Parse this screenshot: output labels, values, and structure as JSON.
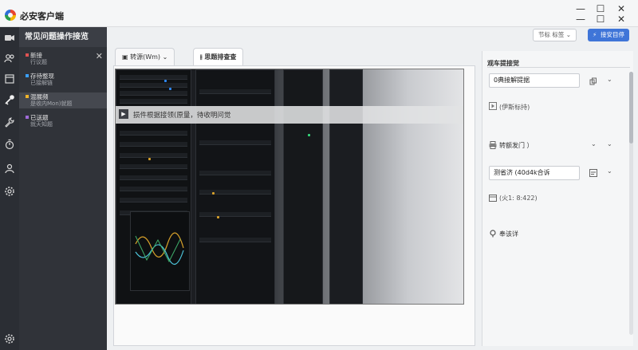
{
  "app": {
    "title": "必安客户端",
    "window_controls": {
      "minimize": "—",
      "maximize": "☐",
      "close": "✕"
    }
  },
  "rail": {
    "icons": [
      "video-icon",
      "users-icon",
      "document-icon",
      "key-icon",
      "wrench-icon",
      "timer-icon",
      "user-group-icon",
      "settings-icon",
      "gear-icon"
    ]
  },
  "faq": {
    "title": "常见问题操作接览",
    "close_glyph": "✕",
    "items": [
      {
        "title": "新接",
        "subtitle": "行议题",
        "color": "#e05252",
        "selected": false
      },
      {
        "title": "存待整现",
        "subtitle": "已接解链",
        "color": "#3aa0ff",
        "selected": false
      },
      {
        "title": "混展频",
        "subtitle": "是收内Mon)就题",
        "color": "#f0b429",
        "selected": true
      },
      {
        "title": "已送题",
        "subtitle": "就天知题",
        "color": "#a06bd8",
        "selected": false
      }
    ]
  },
  "toolbar": {
    "settings_label": "节标 标签",
    "primary_label": "接安目停",
    "primary_icon": "bolt-icon"
  },
  "tabs": [
    {
      "label": "转源(Wm)",
      "icon": "document-icon",
      "has_chevron": true,
      "active": false
    },
    {
      "label": "思题排查查",
      "icon": "sliders-icon",
      "has_chevron": false,
      "active": true
    }
  ],
  "viewer": {
    "overlay_text": "损件根据接领(原量，待收明问觉",
    "overlay_icon": "play-icon"
  },
  "right_panel": {
    "heading": "观车提接觉",
    "field1_value": "0典接解提据",
    "copy_icon": "copy-icon",
    "row2_label": "(伊斯标持)",
    "row3_label": "转额发门 ）",
    "field4_value": "测省济 (40d4k合诉",
    "row5_text": "(火1: 8:422)",
    "row6_label": "奉该详"
  },
  "colors": {
    "accent": "#3f75d8",
    "rail_bg": "#2b2e34",
    "faq_bg": "#303339"
  }
}
